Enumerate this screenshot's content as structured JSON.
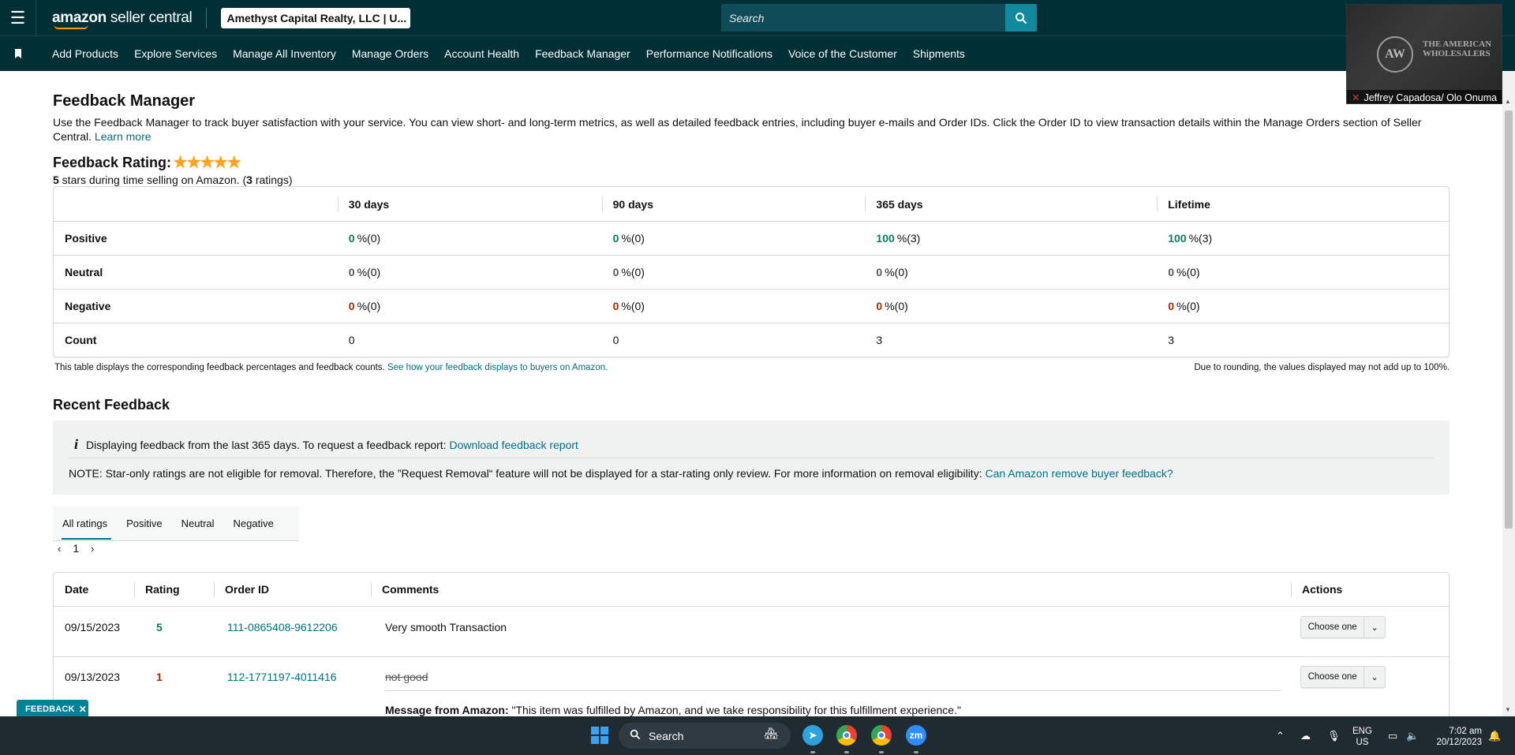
{
  "header": {
    "logo_text_bold": "amazon",
    "logo_text_rest": " seller central",
    "account": "Amethyst Capital Realty, LLC | U...",
    "search_placeholder": "Search"
  },
  "nav": {
    "items": [
      "Add Products",
      "Explore Services",
      "Manage All Inventory",
      "Manage Orders",
      "Account Health",
      "Feedback Manager",
      "Performance Notifications",
      "Voice of the Customer",
      "Shipments"
    ]
  },
  "video": {
    "emblem": "AW",
    "brand": "THE AMERICAN WHOLESALERS",
    "participant": "Jeffrey Capadosa/ Olo Onuma"
  },
  "page": {
    "title": "Feedback Manager",
    "intro": "Use the Feedback Manager to track buyer satisfaction with your service. You can view short- and long-term metrics, as well as detailed feedback entries, including buyer e-mails and Order IDs. Click the Order ID to view transaction details within the Manage Orders section of Seller Central.",
    "learn_more": "Learn more",
    "rating_title": "Feedback Rating:",
    "stars": 5,
    "rating_stars_value": "5",
    "rating_sub_mid": " stars during time selling on Amazon. (",
    "rating_count": "3",
    "rating_sub_end": " ratings)"
  },
  "metrics": {
    "columns": [
      "30 days",
      "90 days",
      "365 days",
      "Lifetime"
    ],
    "rows": [
      {
        "label": "Positive",
        "color": "green",
        "cells": [
          {
            "v": "0",
            "r": "%(0)"
          },
          {
            "v": "0",
            "r": "%(0)"
          },
          {
            "v": "100",
            "r": "%(3)"
          },
          {
            "v": "100",
            "r": "%(3)"
          }
        ]
      },
      {
        "label": "Neutral",
        "color": "grey",
        "cells": [
          {
            "v": "0",
            "r": "%(0)"
          },
          {
            "v": "0",
            "r": "%(0)"
          },
          {
            "v": "0",
            "r": "%(0)"
          },
          {
            "v": "0",
            "r": "%(0)"
          }
        ]
      },
      {
        "label": "Negative",
        "color": "red",
        "cells": [
          {
            "v": "0",
            "r": "%(0)"
          },
          {
            "v": "0",
            "r": "%(0)"
          },
          {
            "v": "0",
            "r": "%(0)"
          },
          {
            "v": "0",
            "r": "%(0)"
          }
        ]
      }
    ],
    "count_label": "Count",
    "counts": [
      "0",
      "0",
      "3",
      "3"
    ],
    "note": "This table displays the corresponding feedback percentages and feedback counts.",
    "note_link": "See how your feedback displays to buyers on Amazon.",
    "rounding_note": "Due to rounding, the values displayed may not add up to 100%."
  },
  "recent": {
    "title": "Recent Feedback",
    "info_icon": "i",
    "info_text": "Displaying feedback from the last 365 days. To request a feedback report:",
    "info_link": "Download feedback report",
    "note_text": "NOTE: Star-only ratings are not eligible for removal. Therefore, the ”Request Removal“ feature will not be displayed for a star-rating only review. For more information on removal eligibility:",
    "note_link": "Can Amazon remove buyer feedback?",
    "tabs": [
      "All ratings",
      "Positive",
      "Neutral",
      "Negative"
    ],
    "page": "1"
  },
  "feedback_table": {
    "headers": [
      "Date",
      "Rating",
      "Order ID",
      "Comments",
      "Actions"
    ],
    "rows": [
      {
        "date": "09/15/2023",
        "rating": "5",
        "order_id": "111-0865408-9612206",
        "comment": "Very smooth Transaction",
        "action": "Choose one"
      },
      {
        "date": "09/13/2023",
        "rating": "1",
        "order_id": "112-1771197-4011416",
        "comment": "not good",
        "action": "Choose one",
        "message_label": "Message from Amazon:",
        "message": "\"This item was fulfilled by Amazon, and we take responsibility for this fulfillment experience.\""
      }
    ]
  },
  "feedback_tag": "FEEDBACK",
  "taskbar": {
    "search": "Search",
    "lang_top": "ENG",
    "lang_bottom": "US",
    "time": "7:02 am",
    "date": "20/12/2023",
    "zoom_label": "zm"
  }
}
